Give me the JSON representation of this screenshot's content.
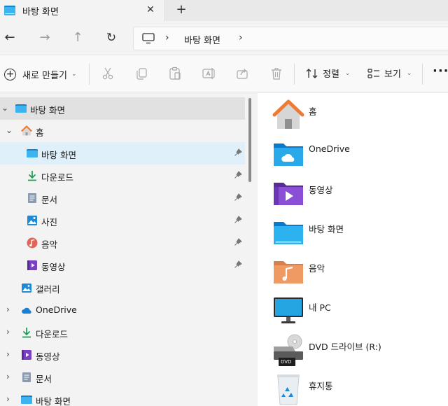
{
  "tab": {
    "title": "바탕 화면",
    "close_glyph": "✕",
    "new_glyph": "+"
  },
  "nav": {
    "back_glyph": "←",
    "forward_glyph": "→",
    "up_glyph": "↑",
    "refresh_glyph": "↻"
  },
  "address": {
    "sep": "›",
    "location": "바탕 화면"
  },
  "commands": {
    "new_label": "새로 만들기",
    "sort_label": "정렬",
    "view_label": "보기",
    "more_glyph": "···",
    "chevron_glyph": "⌄"
  },
  "sidebar": {
    "items": [
      {
        "label": "바탕 화면",
        "icon": "desktop-folder-icon"
      },
      {
        "label": "홈",
        "icon": "home-icon"
      },
      {
        "label": "바탕 화면",
        "icon": "desktop-folder-icon",
        "pinned": true
      },
      {
        "label": "다운로드",
        "icon": "download-icon",
        "pinned": true
      },
      {
        "label": "문서",
        "icon": "document-icon",
        "pinned": true
      },
      {
        "label": "사진",
        "icon": "pictures-icon",
        "pinned": true
      },
      {
        "label": "음악",
        "icon": "music-icon",
        "pinned": true
      },
      {
        "label": "동영상",
        "icon": "video-icon",
        "pinned": true
      },
      {
        "label": "갤러리",
        "icon": "gallery-icon"
      },
      {
        "label": "OneDrive",
        "icon": "onedrive-icon"
      },
      {
        "label": "다운로드",
        "icon": "download-icon"
      },
      {
        "label": "동영상",
        "icon": "video-icon"
      },
      {
        "label": "문서",
        "icon": "document-icon"
      },
      {
        "label": "바탕 화면",
        "icon": "desktop-folder-icon"
      }
    ],
    "expand_glyph": "›",
    "collapse_glyph": "⌄"
  },
  "content": {
    "items": [
      {
        "label": "홈",
        "icon": "home-icon"
      },
      {
        "label": "OneDrive",
        "icon": "onedrive-folder-icon"
      },
      {
        "label": "동영상",
        "icon": "videos-folder-icon"
      },
      {
        "label": "바탕 화면",
        "icon": "desktop-folder-icon"
      },
      {
        "label": "음악",
        "icon": "music-folder-icon"
      },
      {
        "label": "내 PC",
        "icon": "this-pc-icon"
      },
      {
        "label": "DVD 드라이브 (R:)",
        "icon": "dvd-drive-icon",
        "badge": "DVD"
      },
      {
        "label": "휴지통",
        "icon": "recycle-bin-icon"
      }
    ]
  },
  "colors": {
    "accent": "#0078d4",
    "selected_bg": "#dff0fb",
    "folder_blue": "#0f9ee0"
  }
}
